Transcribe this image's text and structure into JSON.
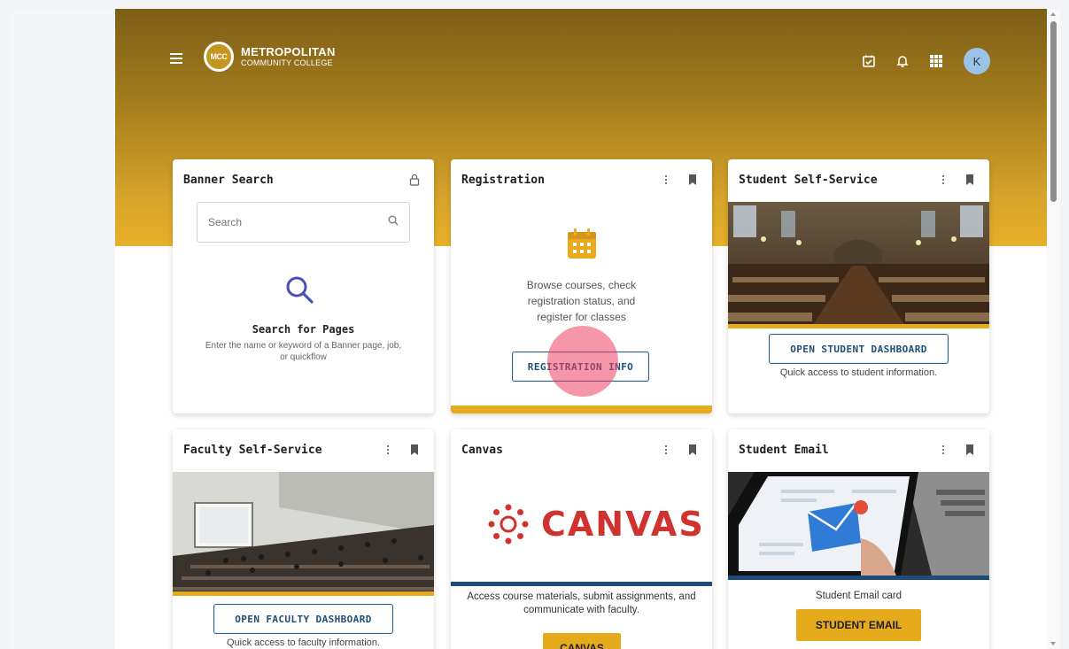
{
  "header": {
    "logo_abbrev": "MCC",
    "college_name_line1": "METROPOLITAN",
    "college_name_line2": "COMMUNITY COLLEGE",
    "avatar_initial": "K"
  },
  "cards": {
    "banner_search": {
      "title": "Banner Search",
      "search_placeholder": "Search",
      "heading": "Search for Pages",
      "description": "Enter the name or keyword of a Banner page, job, or quickflow"
    },
    "registration": {
      "title": "Registration",
      "description": "Browse courses, check registration status, and register for classes",
      "button_label": "REGISTRATION INFO"
    },
    "student_self_service": {
      "title": "Student Self-Service",
      "button_label": "OPEN STUDENT DASHBOARD",
      "caption": "Quick access to student information."
    },
    "faculty_self_service": {
      "title": "Faculty Self-Service",
      "button_label": "OPEN FACULTY DASHBOARD",
      "caption": "Quick access to faculty information."
    },
    "canvas": {
      "title": "Canvas",
      "logo_text": "CANVAS",
      "description": "Access course materials, submit assignments, and communicate with faculty.",
      "button_label": "CANVAS"
    },
    "student_email": {
      "title": "Student Email",
      "caption": "Student Email card",
      "button_label": "STUDENT EMAIL"
    }
  },
  "colors": {
    "gold": "#e6aa1d",
    "navy": "#1f4e75",
    "canvas_red": "#d0322e",
    "hero_top": "#7d5e16",
    "hero_bottom": "#e7b02a"
  }
}
